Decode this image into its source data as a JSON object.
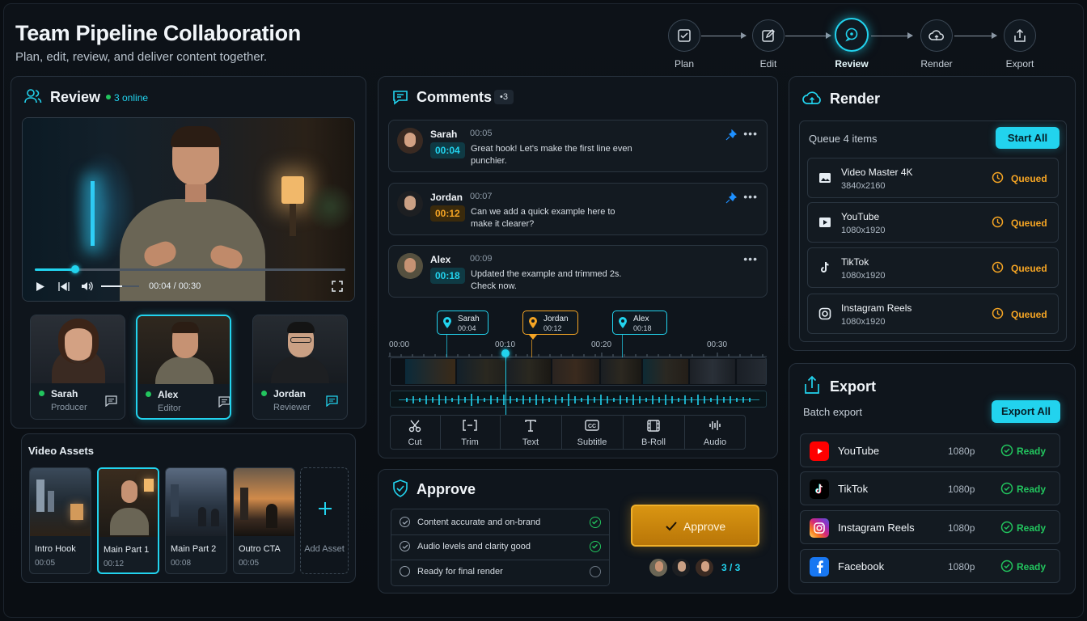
{
  "header": {
    "title": "Team Pipeline Collaboration",
    "subtitle": "Plan, edit, review, and deliver content together."
  },
  "pipeline": {
    "steps": [
      {
        "label": "Plan",
        "icon": "checklist-icon"
      },
      {
        "label": "Edit",
        "icon": "edit-icon"
      },
      {
        "label": "Review",
        "icon": "chat-bubble-icon",
        "active": true
      },
      {
        "label": "Render",
        "icon": "cloud-icon"
      },
      {
        "label": "Export",
        "icon": "share-icon"
      }
    ]
  },
  "review": {
    "title": "Review",
    "online": "3 online",
    "player": {
      "time": "00:04 / 00:30",
      "progress": 0.13,
      "volume": 0.55
    },
    "collaborators": [
      {
        "name": "Sarah",
        "role": "Producer"
      },
      {
        "name": "Alex",
        "role": "Editor",
        "selected": true
      },
      {
        "name": "Jordan",
        "role": "Reviewer"
      }
    ],
    "assets": {
      "title": "Video Assets",
      "items": [
        {
          "name": "Intro Hook",
          "duration": "00:05"
        },
        {
          "name": "Main Part 1",
          "duration": "00:12",
          "selected": true
        },
        {
          "name": "Main Part 2",
          "duration": "00:08"
        },
        {
          "name": "Outro CTA",
          "duration": "00:05"
        }
      ],
      "add_label": "Add Asset"
    }
  },
  "comments": {
    "title": "Comments",
    "count": "•3",
    "items": [
      {
        "author": "Sarah",
        "time": "00:05",
        "timecode": "00:04",
        "text": "Great hook! Let's make the first line even punchier.",
        "pinned": true
      },
      {
        "author": "Jordan",
        "time": "00:07",
        "timecode": "00:12",
        "text": "Can we add a quick example here to make it clearer?",
        "pinned": true
      },
      {
        "author": "Alex",
        "time": "00:09",
        "timecode": "00:18",
        "text": "Updated the example and trimmed 2s. Check now.",
        "pinned": false
      }
    ],
    "markers": [
      {
        "name": "Sarah",
        "time": "00:04"
      },
      {
        "name": "Jordan",
        "time": "00:12"
      },
      {
        "name": "Alex",
        "time": "00:18"
      }
    ],
    "ruler": [
      "00:00",
      "00:10",
      "00:20",
      "00:30"
    ],
    "tools": [
      {
        "label": "Cut",
        "icon": "scissors-icon"
      },
      {
        "label": "Trim",
        "icon": "trim-icon"
      },
      {
        "label": "Text",
        "icon": "text-icon"
      },
      {
        "label": "Subtitle",
        "icon": "subtitle-icon"
      },
      {
        "label": "B-Roll",
        "icon": "film-icon"
      },
      {
        "label": "Audio",
        "icon": "audio-icon"
      }
    ]
  },
  "approve": {
    "title": "Approve",
    "checks": [
      {
        "label": "Content accurate and on-brand",
        "done": true
      },
      {
        "label": "Audio levels and clarity good",
        "done": true
      },
      {
        "label": "Ready for final render",
        "done": false
      }
    ],
    "button": "Approve",
    "approvals": "3 / 3"
  },
  "render": {
    "title": "Render",
    "queue_label": "Queue 4 items",
    "start_all": "Start All",
    "items": [
      {
        "name": "Video Master 4K",
        "resolution": "3840x2160",
        "status": "Queued",
        "icon": "image-icon"
      },
      {
        "name": "YouTube",
        "resolution": "1080x1920",
        "status": "Queued",
        "icon": "play-box-icon"
      },
      {
        "name": "TikTok",
        "resolution": "1080x1920",
        "status": "Queued",
        "icon": "tiktok-icon"
      },
      {
        "name": "Instagram Reels",
        "resolution": "1080x1920",
        "status": "Queued",
        "icon": "instagram-icon"
      }
    ]
  },
  "export": {
    "title": "Export",
    "batch_label": "Batch export",
    "export_all": "Export All",
    "items": [
      {
        "name": "YouTube",
        "resolution": "1080p",
        "status": "Ready",
        "icon": "youtube-icon",
        "color": "#ff0000"
      },
      {
        "name": "TikTok",
        "resolution": "1080p",
        "status": "Ready",
        "icon": "tiktok-icon",
        "color": "#000000"
      },
      {
        "name": "Instagram Reels",
        "resolution": "1080p",
        "status": "Ready",
        "icon": "instagram-icon",
        "color": "#d62976"
      },
      {
        "name": "Facebook",
        "resolution": "1080p",
        "status": "Ready",
        "icon": "facebook-icon",
        "color": "#1877f2"
      }
    ]
  },
  "colors": {
    "accent": "#22d3ee",
    "queued": "#f5a524",
    "ready": "#22c55e",
    "approve": "#d48a0f"
  }
}
